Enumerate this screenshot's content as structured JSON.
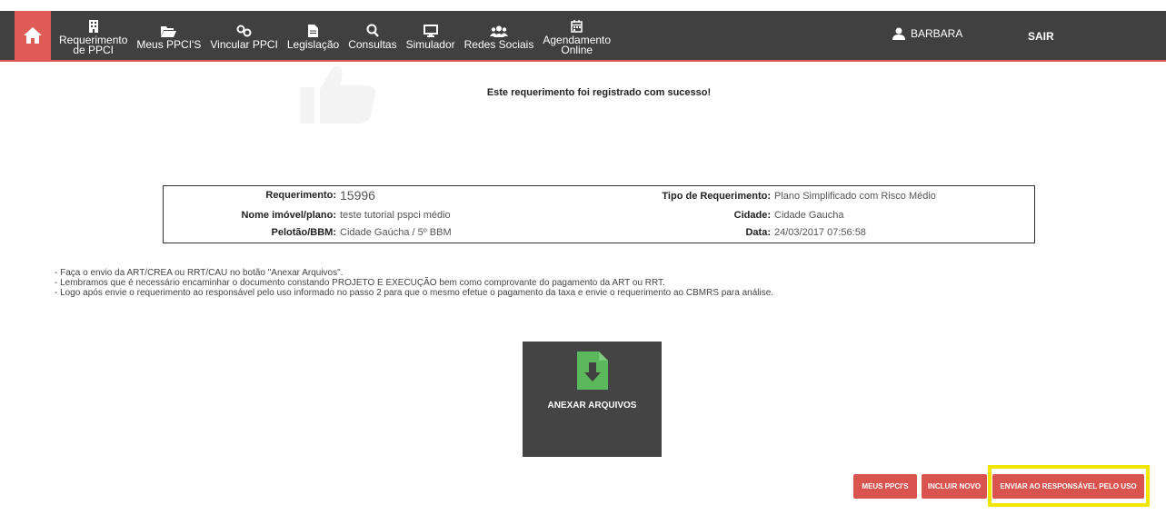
{
  "nav": {
    "items": [
      {
        "label1": "Requerimento",
        "label2": "de PPCI",
        "icon": "building-icon"
      },
      {
        "label1": "Meus PPCI'S",
        "icon": "folder-open-icon"
      },
      {
        "label1": "Vincular PPCI",
        "icon": "link-icon"
      },
      {
        "label1": "Legislação",
        "icon": "document-icon"
      },
      {
        "label1": "Consultas",
        "icon": "search-icon"
      },
      {
        "label1": "Simulador",
        "icon": "monitor-icon"
      },
      {
        "label1": "Redes Sociais",
        "icon": "users-icon"
      },
      {
        "label1": "Agendamento",
        "label2": "Online",
        "icon": "calendar-icon"
      }
    ],
    "user": "BARBARA",
    "logout": "SAIR"
  },
  "success_message": "Este requerimento foi registrado com sucesso!",
  "info": {
    "requerimento_label": "Requerimento:",
    "requerimento_value": "15996",
    "nome_label": "Nome imóvel/plano:",
    "nome_value": "teste tutorial pspci médio",
    "pelotao_label": "Pelotão/BBM:",
    "pelotao_value": "Cidade Gaúcha / 5º BBM",
    "tipo_label": "Tipo de Requerimento:",
    "tipo_value": "Plano Simplificado com Risco Médio",
    "cidade_label": "Cidade:",
    "cidade_value": "Cidade Gaucha",
    "data_label": "Data:",
    "data_value": "24/03/2017 07:56:58"
  },
  "notes": [
    "- Faça o envio da ART/CREA ou RRT/CAU no botão \"Anexar Arquivos\".",
    "- Lembramos que é necessário encaminhar o documento constando PROJETO E EXECUÇÃO bem como comprovante do pagamento da ART ou RRT.",
    "- Logo após envie o requerimento ao responsável pelo uso informado no passo 2 para que o mesmo efetue o pagamento da taxa e envie o requerimento ao CBMRS para análise."
  ],
  "attach_label": "ANEXAR ARQUIVOS",
  "buttons": {
    "meus": "MEUS PPCI'S",
    "incluir": "INCLUIR NOVO",
    "enviar": "ENVIAR AO RESPONSÁVEL PELO USO"
  },
  "colors": {
    "navbar": "#404040",
    "accent": "#d9534f",
    "highlight": "#f2e600",
    "attach_icon": "#5cb85c"
  }
}
